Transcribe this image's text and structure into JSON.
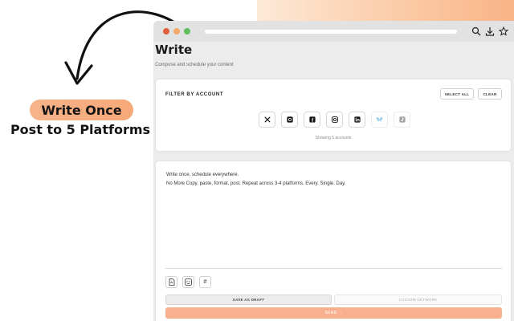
{
  "promo": {
    "headline": "Write Once",
    "subheadline": "Post to 5 Platforms",
    "pill_color": "#f6b389"
  },
  "browser": {
    "icons": [
      "search-icon",
      "download-icon",
      "star-icon"
    ]
  },
  "page": {
    "title": "Write",
    "subtitle": "Compose and schedule your content"
  },
  "filter": {
    "label": "FILTER BY ACCOUNT",
    "select_all": "SELECT ALL",
    "clear": "CLEAR",
    "accounts": [
      {
        "platform": "x",
        "icon": "x-icon",
        "enabled": true
      },
      {
        "platform": "threads",
        "icon": "threads-icon",
        "enabled": true
      },
      {
        "platform": "facebook",
        "icon": "facebook-icon",
        "enabled": true
      },
      {
        "platform": "instagram",
        "icon": "instagram-icon",
        "enabled": true
      },
      {
        "platform": "linkedin",
        "icon": "linkedin-icon",
        "enabled": true
      },
      {
        "platform": "bluesky",
        "icon": "bluesky-icon",
        "enabled": false
      },
      {
        "platform": "tiktok",
        "icon": "tiktok-icon",
        "enabled": false
      }
    ],
    "showing": "Showing 5 accounts"
  },
  "composer": {
    "line1": "Write once, schedule everywhere.",
    "line2": "No More Copy, paste, format, post. Repeat across 3-4 platforms. Every. Single. Day.",
    "tools": [
      "document-icon",
      "image-icon",
      "hashtag-icon"
    ],
    "hashtag_glyph": "#",
    "save_draft": "SAVE AS DRAFT",
    "custom_network": "CUSTOM NETWORK",
    "send": "SEND →"
  },
  "colors": {
    "accent": "#f8b08f",
    "window_bg": "#ececec"
  }
}
